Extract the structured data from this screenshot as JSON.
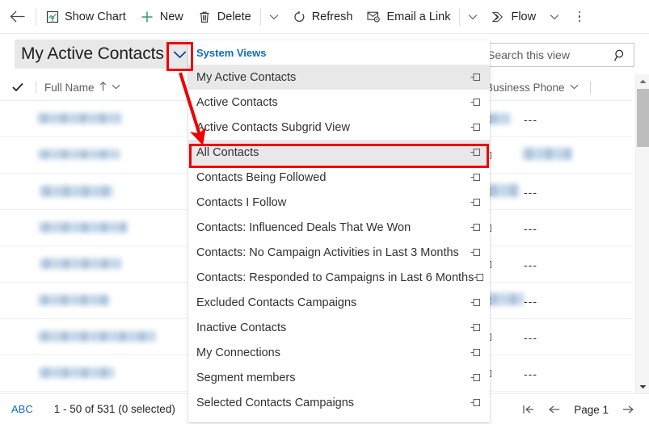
{
  "app": {
    "title": "Dynamics 365 Contacts Grid"
  },
  "commandbar": {
    "back_icon": "back-arrow-icon",
    "buttons": [
      {
        "label": "Show Chart",
        "icon": "show-chart-icon"
      },
      {
        "label": "New",
        "icon": "plus-icon"
      },
      {
        "label": "Delete",
        "icon": "trash-icon"
      },
      {
        "label": "Refresh",
        "icon": "refresh-icon"
      },
      {
        "label": "Email a Link",
        "icon": "email-link-icon"
      },
      {
        "label": "Flow",
        "icon": "flow-icon"
      }
    ],
    "overflow_label": "more-commands"
  },
  "viewselector": {
    "current_view": "My Active Contacts",
    "caret_icon": "chevron-down-icon",
    "caret_color": "#0b3d91",
    "pill_background": "#e8e8e8"
  },
  "search": {
    "placeholder": "Search this view",
    "value": "Search this view",
    "icon": "search-icon"
  },
  "grid": {
    "select_all_icon": "checkmark-icon",
    "columns": [
      {
        "label": "Full Name",
        "sort_icon": "sort-ascending-arrow",
        "menu_icon": "chevron-down-icon"
      },
      {
        "label": "Business Phone",
        "menu_icon": "chevron-down-icon"
      }
    ],
    "rows": [
      {
        "name": "redacted",
        "phone": "---"
      },
      {
        "name": "redacted",
        "phone": "---"
      },
      {
        "name": "redacted",
        "phone": "---"
      },
      {
        "name": "redacted",
        "phone": "---"
      },
      {
        "name": "redacted",
        "phone": "---"
      },
      {
        "name": "redacted",
        "phone": "---"
      },
      {
        "name": "redacted",
        "phone": "---"
      },
      {
        "name": "redacted",
        "phone": "---"
      }
    ],
    "empty_value": "---",
    "scrollbar": {
      "up_icon": "scroll-up-arrow",
      "down_icon": "scroll-down-arrow"
    }
  },
  "flyout": {
    "header": "System Views",
    "header_color": "#0f6cbd",
    "pin_icon": "pin-icon",
    "items": [
      {
        "label": "My Active Contacts",
        "selected": true
      },
      {
        "label": "Active Contacts",
        "selected": false
      },
      {
        "label": "Active Contacts Subgrid View",
        "selected": false
      },
      {
        "label": "All Contacts",
        "selected": false,
        "highlighted": true
      },
      {
        "label": "Contacts Being Followed",
        "selected": false
      },
      {
        "label": "Contacts I Follow",
        "selected": false
      },
      {
        "label": "Contacts: Influenced Deals That We Won",
        "selected": false
      },
      {
        "label": "Contacts: No Campaign Activities in Last 3 Months",
        "selected": false
      },
      {
        "label": "Contacts: Responded to Campaigns in Last 6 Months",
        "selected": false
      },
      {
        "label": "Excluded Contacts Campaigns",
        "selected": false
      },
      {
        "label": "Inactive Contacts",
        "selected": false
      },
      {
        "label": "My Connections",
        "selected": false
      },
      {
        "label": "Segment members",
        "selected": false
      },
      {
        "label": "Selected Contacts Campaigns",
        "selected": false
      }
    ]
  },
  "statusbar": {
    "index_label": "ABC",
    "record_count": "1 - 50 of 531 (0 selected)",
    "pager": {
      "first_icon": "first-page-arrow",
      "prev_icon": "previous-page-arrow",
      "page_label": "Page 1",
      "next_icon": "next-page-arrow"
    }
  },
  "annotations": {
    "accent_color": "#ee0000",
    "caret_highlight": "view-selector-caret",
    "item_highlight": "All Contacts",
    "arrow": "red-arrow-from-caret-to-all-contacts"
  }
}
